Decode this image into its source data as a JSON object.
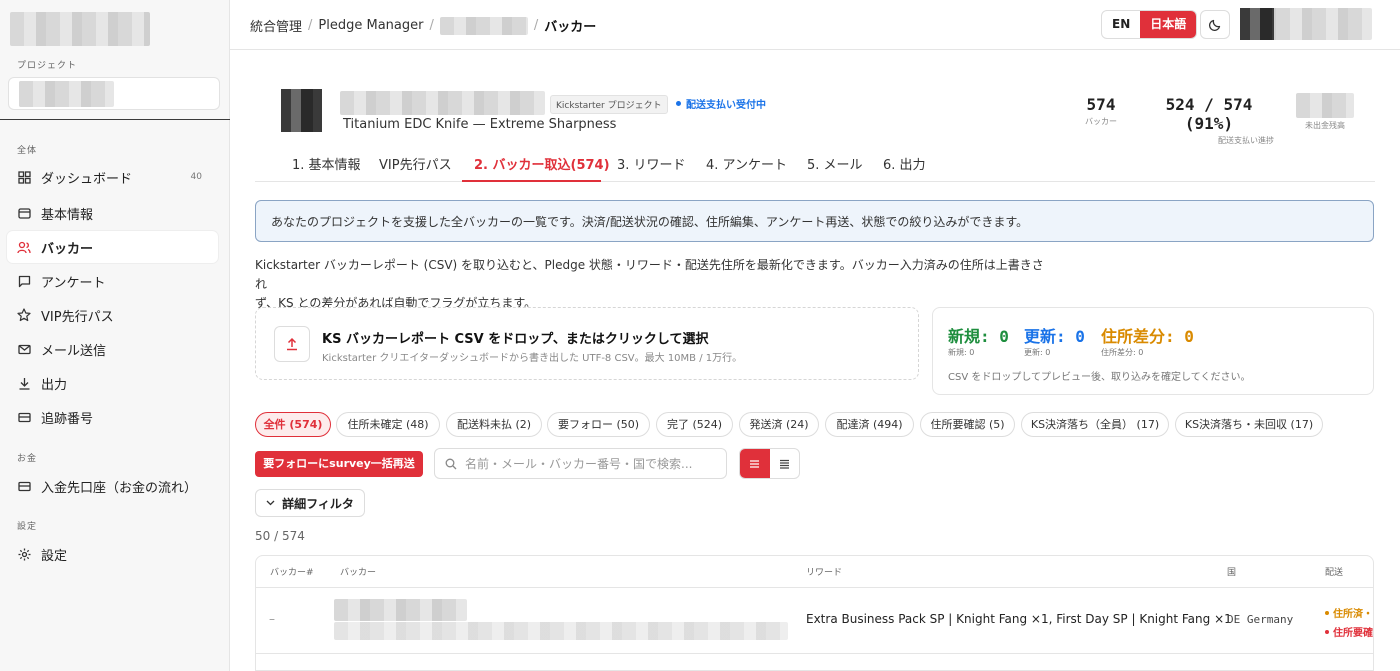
{
  "sidebar": {
    "section_project": "プロジェクト",
    "section_all": "全体",
    "section_money": "お金",
    "section_settings": "設定",
    "items": [
      {
        "label": "ダッシュボード",
        "icon": "dashboard-grid-icon",
        "badge": "40"
      },
      {
        "label": "基本情報",
        "icon": "info-card-icon"
      },
      {
        "label": "バッカー",
        "icon": "users-icon",
        "active": true
      },
      {
        "label": "アンケート",
        "icon": "survey-message-icon"
      },
      {
        "label": "VIP先行パス",
        "icon": "star-icon"
      },
      {
        "label": "メール送信",
        "icon": "mail-icon"
      },
      {
        "label": "出力",
        "icon": "download-icon"
      },
      {
        "label": "追跡番号",
        "icon": "tracking-card-icon"
      },
      {
        "label": "入金先口座（お金の流れ）",
        "icon": "bank-card-icon"
      },
      {
        "label": "設定",
        "icon": "gear-icon"
      }
    ]
  },
  "topbar": {
    "crumb_1": "統合管理",
    "crumb_2": "Pledge Manager",
    "crumb_current": "バッカー",
    "lang_en": "EN",
    "lang_ja": "日本語"
  },
  "project": {
    "ks_tag": "Kickstarter プロジェクト",
    "status": "配送支払い受付中",
    "subtitle": "Titanium EDC Knife — Extreme Sharpness",
    "stat_backers": "574",
    "stat_backers_label": "バッカー",
    "stat_progress": "524 / 574 (91%)",
    "stat_progress_label": "配送支払い進捗",
    "stat_unpaid_label": "未出金残高"
  },
  "tabs": [
    "1. 基本情報",
    "VIP先行パス",
    "2. バッカー取込(574)",
    "3. リワード",
    "4. アンケート",
    "5. メール",
    "6. 出力"
  ],
  "info": "あなたのプロジェクトを支援した全バッカーの一覧です。決済/配送状況の確認、住所編集、アンケート再送、状態での絞り込みができます。",
  "desc_line1": "Kickstarter バッカーレポート (CSV) を取り込むと、Pledge 状態・リワード・配送先住所を最新化できます。バッカー入力済みの住所は上書きされ",
  "desc_line2": "ず、KS との差分があれば自動でフラグが立ちます。",
  "drop": {
    "title": "KS バッカーレポート CSV をドロップ、またはクリックして選択",
    "sub": "Kickstarter クリエイターダッシュボードから書き出した UTF-8 CSV。最大 10MB / 1万行。"
  },
  "counts": {
    "new": "新規: 0",
    "new_sub": "新規: 0",
    "new_color": "#1e8e3e",
    "upd": "更新: 0",
    "upd_sub": "更新: 0",
    "upd_color": "#1a73e8",
    "diff": "住所差分: 0",
    "diff_sub": "住所差分: 0",
    "diff_color": "#d98a00",
    "note": "CSV をドロップしてプレビュー後、取り込みを確定してください。"
  },
  "chips": [
    "全件 (574)",
    "住所未確定 (48)",
    "配送料未払 (2)",
    "要フォロー (50)",
    "完了 (524)",
    "発送済 (24)",
    "配達済 (494)",
    "住所要確認 (5)",
    "KS決済落ち（全員） (17)",
    "KS決済落ち・未回収 (17)"
  ],
  "actions": {
    "resend": "要フォローにsurvey一括再送",
    "search_placeholder": "名前・メール・バッカー番号・国で検索...",
    "adv_filter": "詳細フィルタ",
    "count_line": "50 / 574"
  },
  "table": {
    "headers": [
      "バッカー#",
      "バッカー",
      "リワード",
      "国",
      "配送"
    ],
    "row": {
      "num": "–",
      "reward": "Extra Business Pack SP | Knight Fang ×1, First Day SP | Knight Fang ×1",
      "country": "DE Germany",
      "status_1": "住所済・",
      "status_2": "住所要確",
      "status_1_color": "#d98a00",
      "status_2_color": "#e0303a"
    }
  },
  "accent": "#e0303a"
}
